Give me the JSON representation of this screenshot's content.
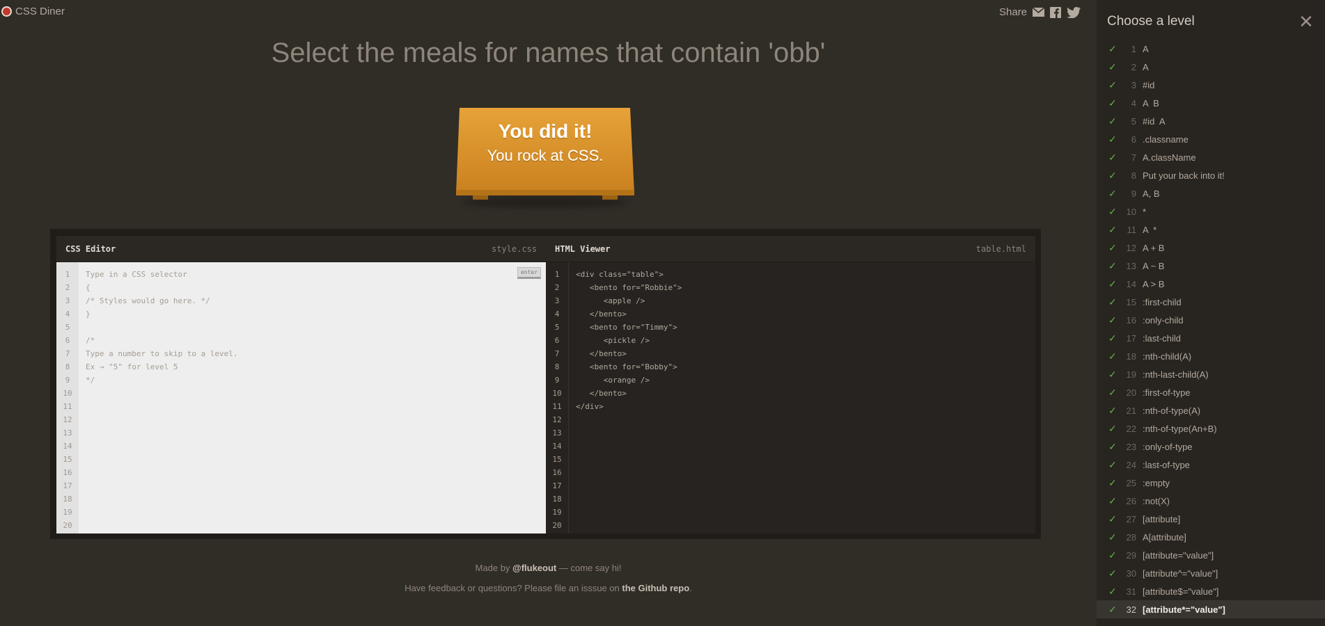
{
  "app": {
    "title": "CSS Diner"
  },
  "share": {
    "label": "Share"
  },
  "instruction": "Select the meals for names that contain 'obb'",
  "table": {
    "line1": "You did it!",
    "line2": "You rock at CSS."
  },
  "css_editor": {
    "header": "CSS Editor",
    "file": "style.css",
    "enter_label": "enter",
    "gutter": "1\n2\n3\n4\n5\n6\n7\n8\n9\n10\n11\n12\n13\n14\n15\n16\n17\n18\n19\n20",
    "code": "Type in a CSS selector\n{\n/* Styles would go here. */\n}\n\n/*\nType a number to skip to a level.\nEx → \"5\" for level 5\n*/"
  },
  "html_viewer": {
    "header": "HTML Viewer",
    "file": "table.html",
    "gutter": "1\n2\n3\n4\n5\n6\n7\n8\n9\n10\n11\n12\n13\n14\n15\n16\n17\n18\n19\n20",
    "code": "<div class=\"table\">\n   <bento for=\"Robbie\">\n      <apple />\n   </bento>\n   <bento for=\"Timmy\">\n      <pickle />\n   </bento>\n   <bento for=\"Bobby\">\n      <orange />\n   </bento>\n</div>"
  },
  "footer": {
    "made_by_prefix": "Made by ",
    "made_by_handle": "@flukeout",
    "made_by_suffix": " — come say hi!",
    "feedback_prefix": "Have feedback or questions? Please file an isssue on ",
    "feedback_link": "the Github repo",
    "feedback_suffix": "."
  },
  "sidebar": {
    "title": "Choose a level",
    "current_level": 32,
    "levels": [
      {
        "num": "1",
        "label": "A"
      },
      {
        "num": "2",
        "label": "A"
      },
      {
        "num": "3",
        "label": "#id"
      },
      {
        "num": "4",
        "label": "A  B"
      },
      {
        "num": "5",
        "label": "#id  A"
      },
      {
        "num": "6",
        "label": ".classname"
      },
      {
        "num": "7",
        "label": "A.className"
      },
      {
        "num": "8",
        "label": "Put your back into it!"
      },
      {
        "num": "9",
        "label": "A, B"
      },
      {
        "num": "10",
        "label": "*"
      },
      {
        "num": "11",
        "label": "A  *"
      },
      {
        "num": "12",
        "label": "A + B"
      },
      {
        "num": "13",
        "label": "A ~ B"
      },
      {
        "num": "14",
        "label": "A > B"
      },
      {
        "num": "15",
        "label": ":first-child"
      },
      {
        "num": "16",
        "label": ":only-child"
      },
      {
        "num": "17",
        "label": ":last-child"
      },
      {
        "num": "18",
        "label": ":nth-child(A)"
      },
      {
        "num": "19",
        "label": ":nth-last-child(A)"
      },
      {
        "num": "20",
        "label": ":first-of-type"
      },
      {
        "num": "21",
        "label": ":nth-of-type(A)"
      },
      {
        "num": "22",
        "label": ":nth-of-type(An+B)"
      },
      {
        "num": "23",
        "label": ":only-of-type"
      },
      {
        "num": "24",
        "label": ":last-of-type"
      },
      {
        "num": "25",
        "label": ":empty"
      },
      {
        "num": "26",
        "label": ":not(X)"
      },
      {
        "num": "27",
        "label": "[attribute]"
      },
      {
        "num": "28",
        "label": "A[attribute]"
      },
      {
        "num": "29",
        "label": "[attribute=\"value\"]"
      },
      {
        "num": "30",
        "label": "[attribute^=\"value\"]"
      },
      {
        "num": "31",
        "label": "[attribute$=\"value\"]"
      },
      {
        "num": "32",
        "label": "[attribute*=\"value\"]"
      }
    ]
  },
  "colors": {
    "check": "#5fb04a",
    "table": "#e7a238",
    "background": "#302c26"
  }
}
